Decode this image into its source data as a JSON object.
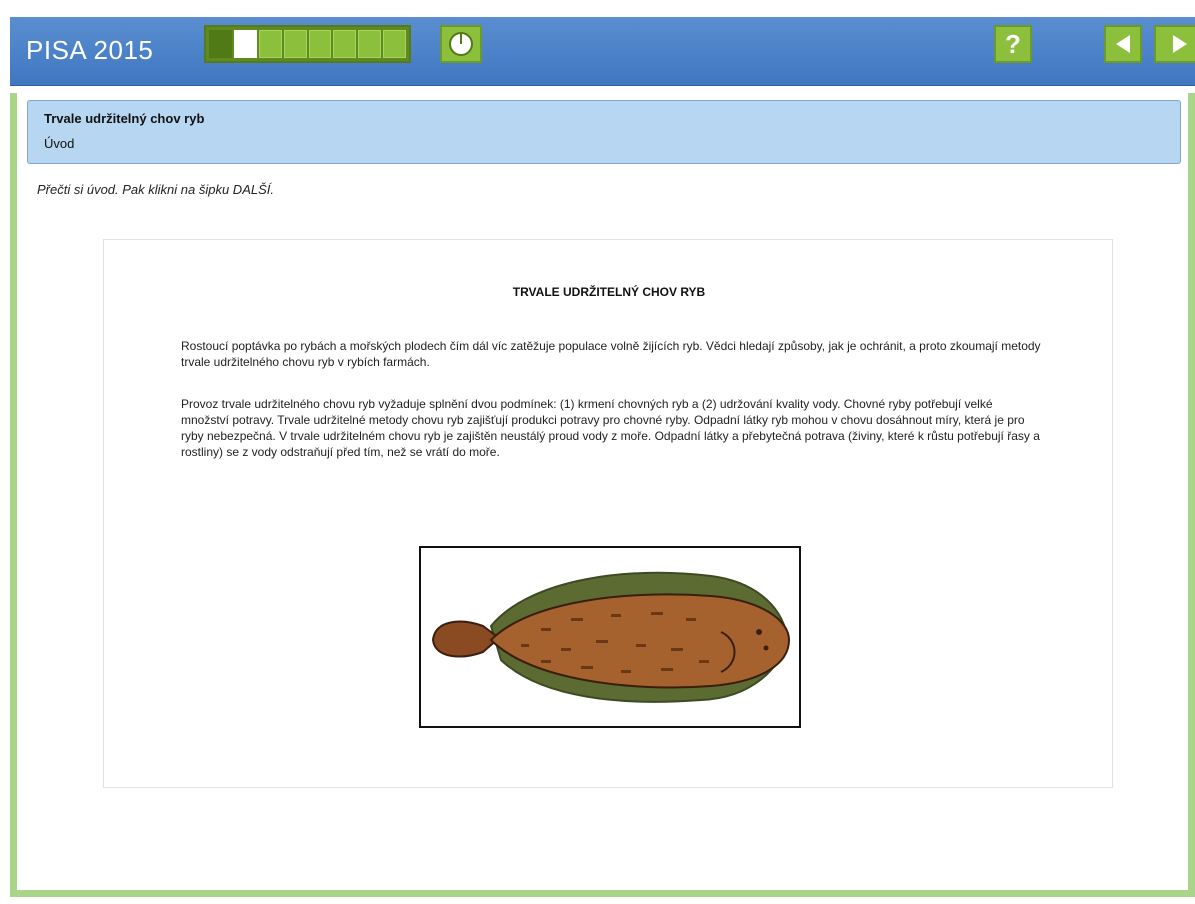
{
  "header": {
    "app_title": "PISA 2015",
    "progress_segments": 8,
    "progress_current": 2,
    "icons": [
      "clock-icon",
      "help-icon",
      "arrow-left-icon",
      "arrow-right-icon"
    ],
    "help_label": "?"
  },
  "unit": {
    "title": "Trvale udržitelný chov ryb",
    "subtitle": "Úvod"
  },
  "instruction": "Přečti si úvod. Pak klikni na šipku DALŠÍ.",
  "content": {
    "title": "TRVALE UDRŽITELNÝ CHOV RYB",
    "paragraph1": "Rostoucí poptávka po rybách a mořských plodech čím dál víc zatěžuje populace volně žijících ryb. Vědci hledají způsoby, jak je ochránit, a proto zkoumají metody trvale udržitelného chovu ryb v rybích farmách.",
    "paragraph2": "Provoz trvale udržitelného chovu ryb vyžaduje splnění dvou podmínek: (1) krmení chovných ryb a (2) udržování kvality vody. Chovné ryby potřebují velké množství potravy. Trvale udržitelné metody chovu ryb zajišťují produkci potravy pro chovné ryby. Odpadní látky ryb mohou v chovu dosáhnout míry, která je pro ryby nebezpečná. V trvale udržitelném chovu ryb je zajištěn neustálý proud vody z moře. Odpadní látky a přebytečná potrava (živiny, které k růstu potřebují řasy a rostliny) se z vody odstraňují před tím, než se vrátí do moře."
  },
  "colors": {
    "header_blue": "#4a82c8",
    "button_green": "#8cbf3c",
    "frame_green": "#a8d58a",
    "panel_blue": "#b7d6f2"
  }
}
